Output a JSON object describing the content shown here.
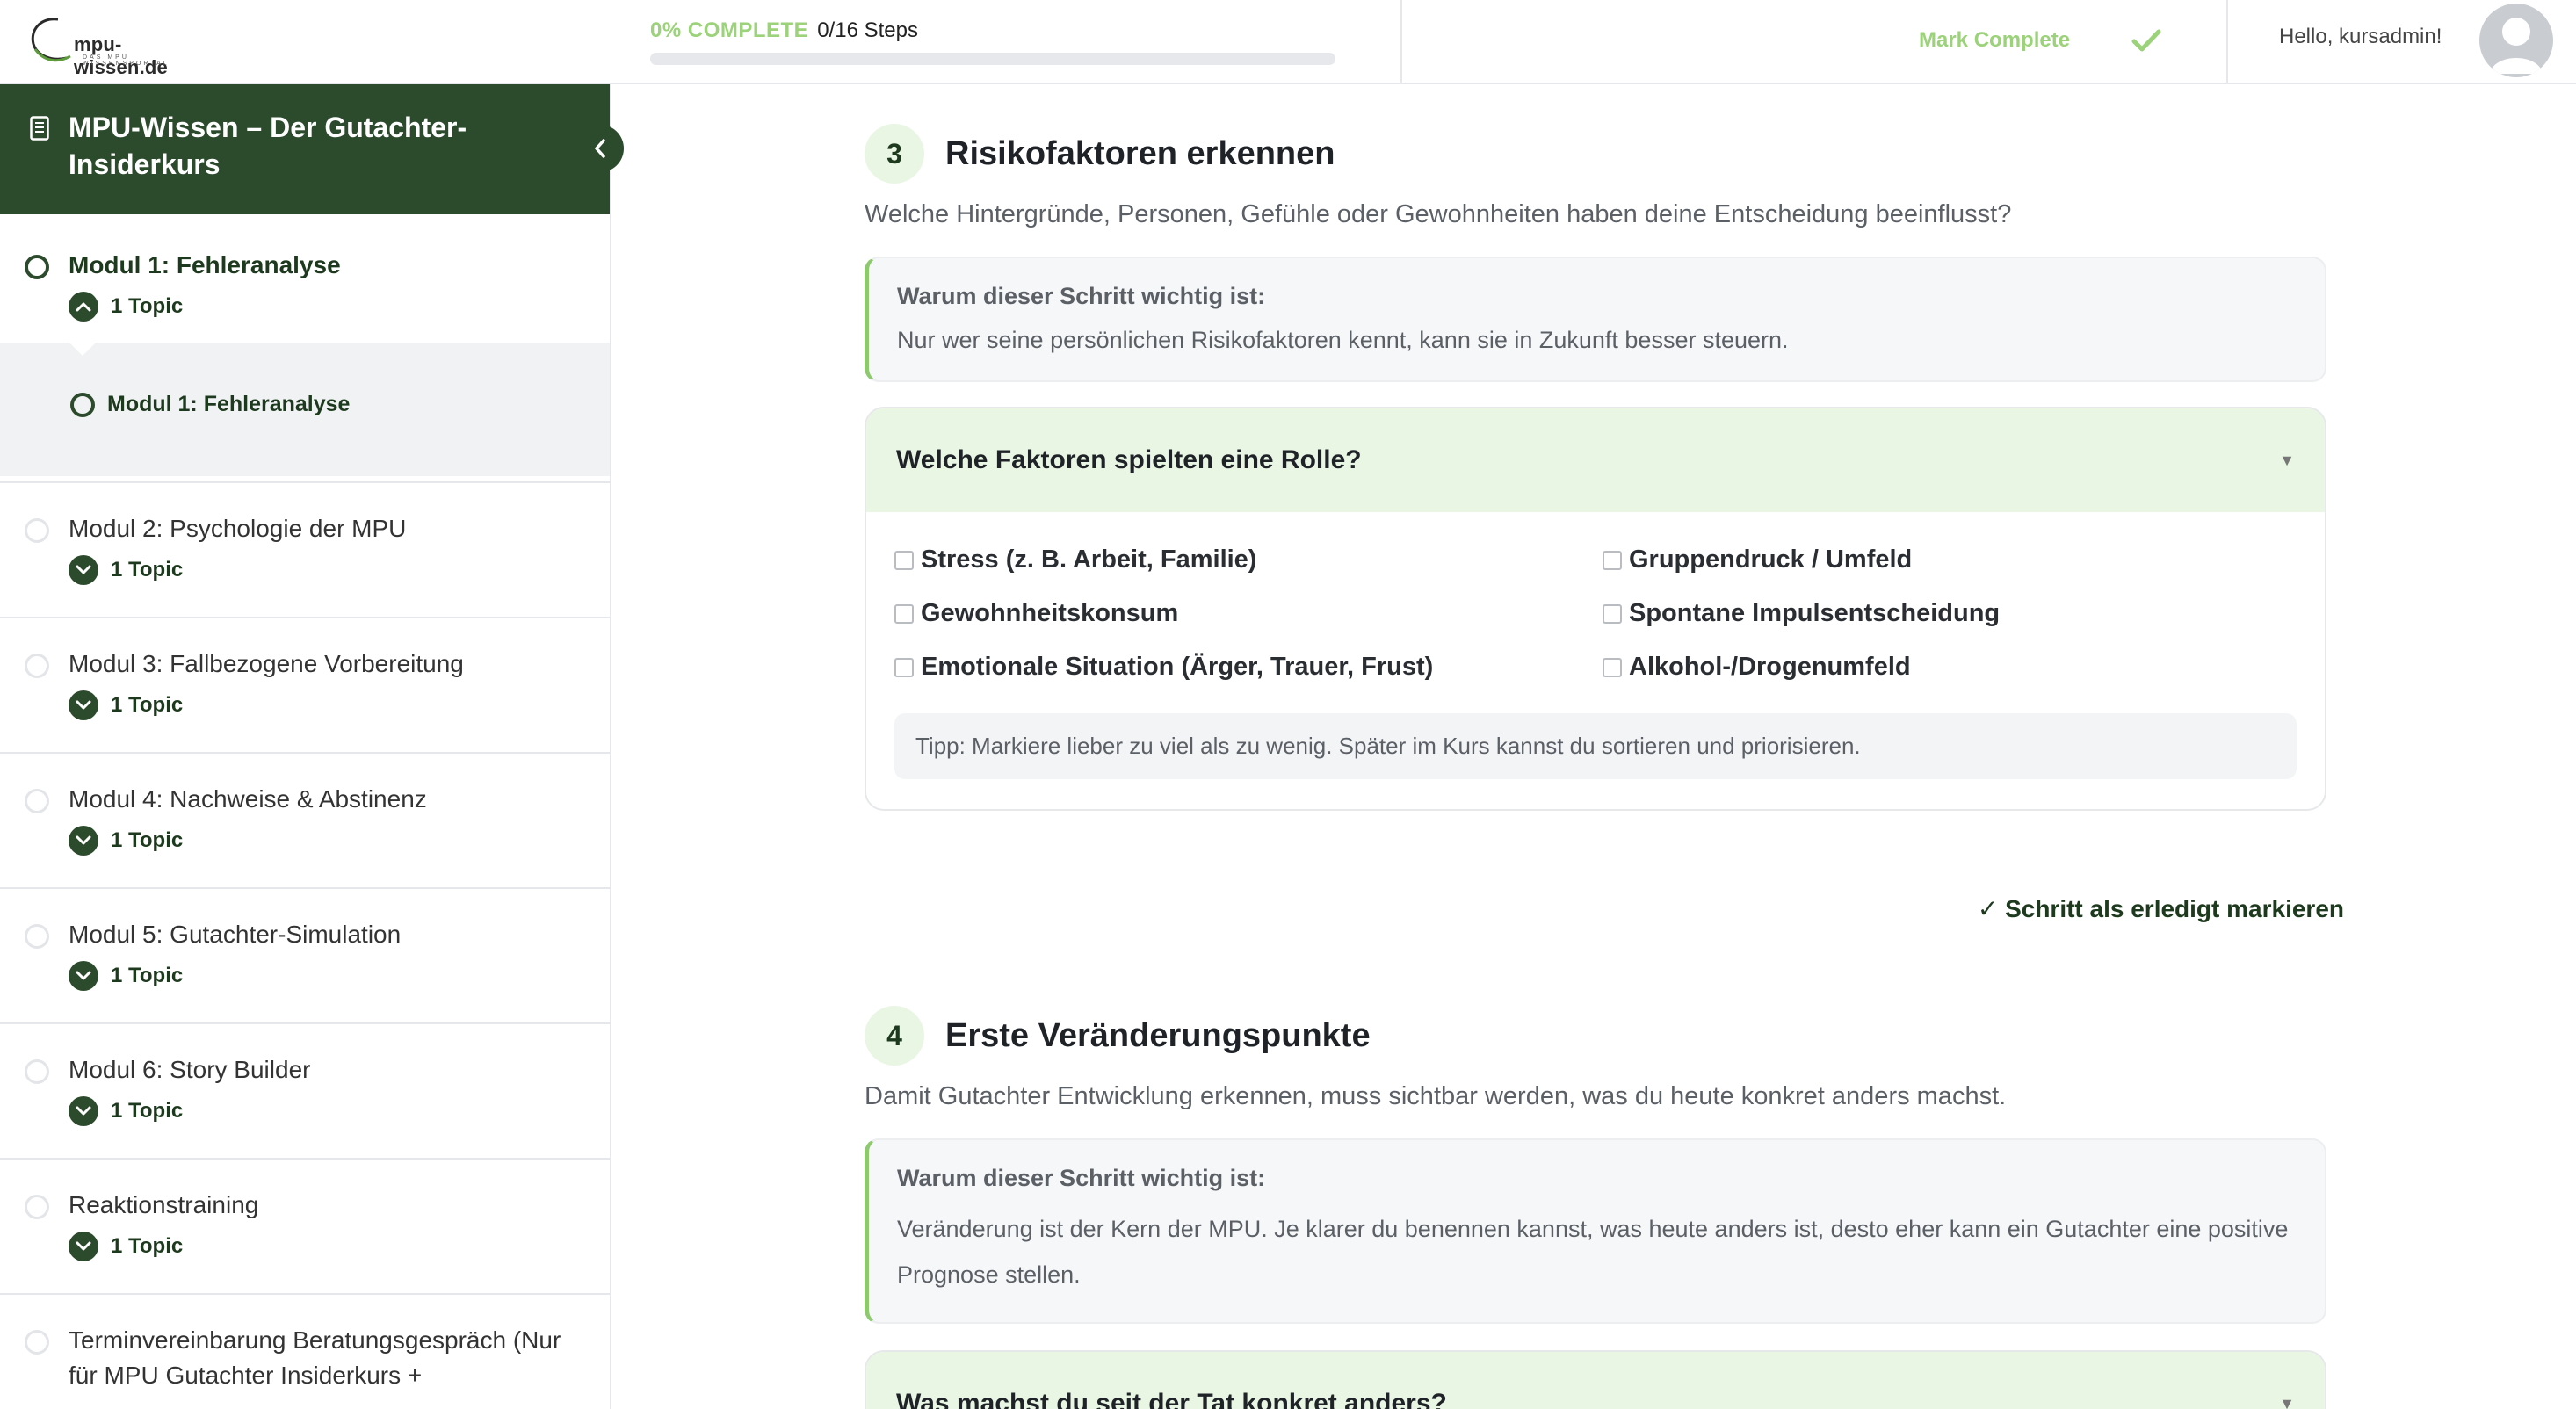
{
  "header": {
    "logo_text": "mpu-wissen.de",
    "logo_sub": "DAS MPU WISSENSPORTAL",
    "progress_pct": "0% COMPLETE",
    "progress_steps": "0/16 Steps",
    "progress_value": 0,
    "mark_complete": "Mark Complete",
    "greeting": "Hello, kursadmin!"
  },
  "sidebar": {
    "course_title": "MPU-Wissen – Der Gutachter-Insiderkurs",
    "expanded_module": {
      "title": "Modul 1: Fehleranalyse",
      "topic_count": "1 Topic",
      "topic": "Modul 1: Fehleranalyse"
    },
    "modules": [
      {
        "title": "Modul 2: Psychologie der MPU",
        "topic_count": "1 Topic"
      },
      {
        "title": "Modul 3: Fallbezogene Vorbereitung",
        "topic_count": "1 Topic"
      },
      {
        "title": "Modul 4: Nachweise & Abstinenz",
        "topic_count": "1 Topic"
      },
      {
        "title": "Modul 5: Gutachter-Simulation",
        "topic_count": "1 Topic"
      },
      {
        "title": "Modul 6: Story Builder",
        "topic_count": "1 Topic"
      },
      {
        "title": "Reaktionstraining",
        "topic_count": "1 Topic"
      },
      {
        "title": "Terminvereinbarung Beratungsgespräch (Nur für MPU Gutachter Insiderkurs +",
        "topic_count": ""
      }
    ]
  },
  "steps": [
    {
      "number": "3",
      "title": "Risikofaktoren erkennen",
      "description": "Welche Hintergründe, Personen, Gefühle oder Gewohnheiten haben deine Entscheidung beeinflusst?",
      "why_title": "Warum dieser Schritt wichtig ist:",
      "why_text": "Nur wer seine persönlichen Risikofaktoren kennt, kann sie in Zukunft besser steuern.",
      "accordion_title": "Welche Faktoren spielten eine Rolle?",
      "options": [
        "Stress (z. B. Arbeit, Familie)",
        "Gruppendruck / Umfeld",
        "Gewohnheitskonsum",
        "Spontane Impulsentscheidung",
        "Emotionale Situation (Ärger, Trauer, Frust)",
        "Alkohol-/Drogenumfeld"
      ],
      "tip": "Tipp: Markiere lieber zu viel als zu wenig. Später im Kurs kannst du sortieren und priorisieren.",
      "done_label": "✓ Schritt als erledigt markieren"
    },
    {
      "number": "4",
      "title": "Erste Veränderungspunkte",
      "description": "Damit Gutachter Entwicklung erkennen, muss sichtbar werden, was du heute konkret anders machst.",
      "why_title": "Warum dieser Schritt wichtig ist:",
      "why_text": "Veränderung ist der Kern der MPU. Je klarer du benennen kannst, was heute anders ist, desto eher kann ein Gutachter eine positive Prognose stellen.",
      "accordion_title": "Was machst du seit der Tat konkret anders?"
    }
  ],
  "colors": {
    "brand_dark_green": "#2c4a2c",
    "accent_green": "#8cca6d",
    "light_green_bg": "#e9f6e4"
  }
}
